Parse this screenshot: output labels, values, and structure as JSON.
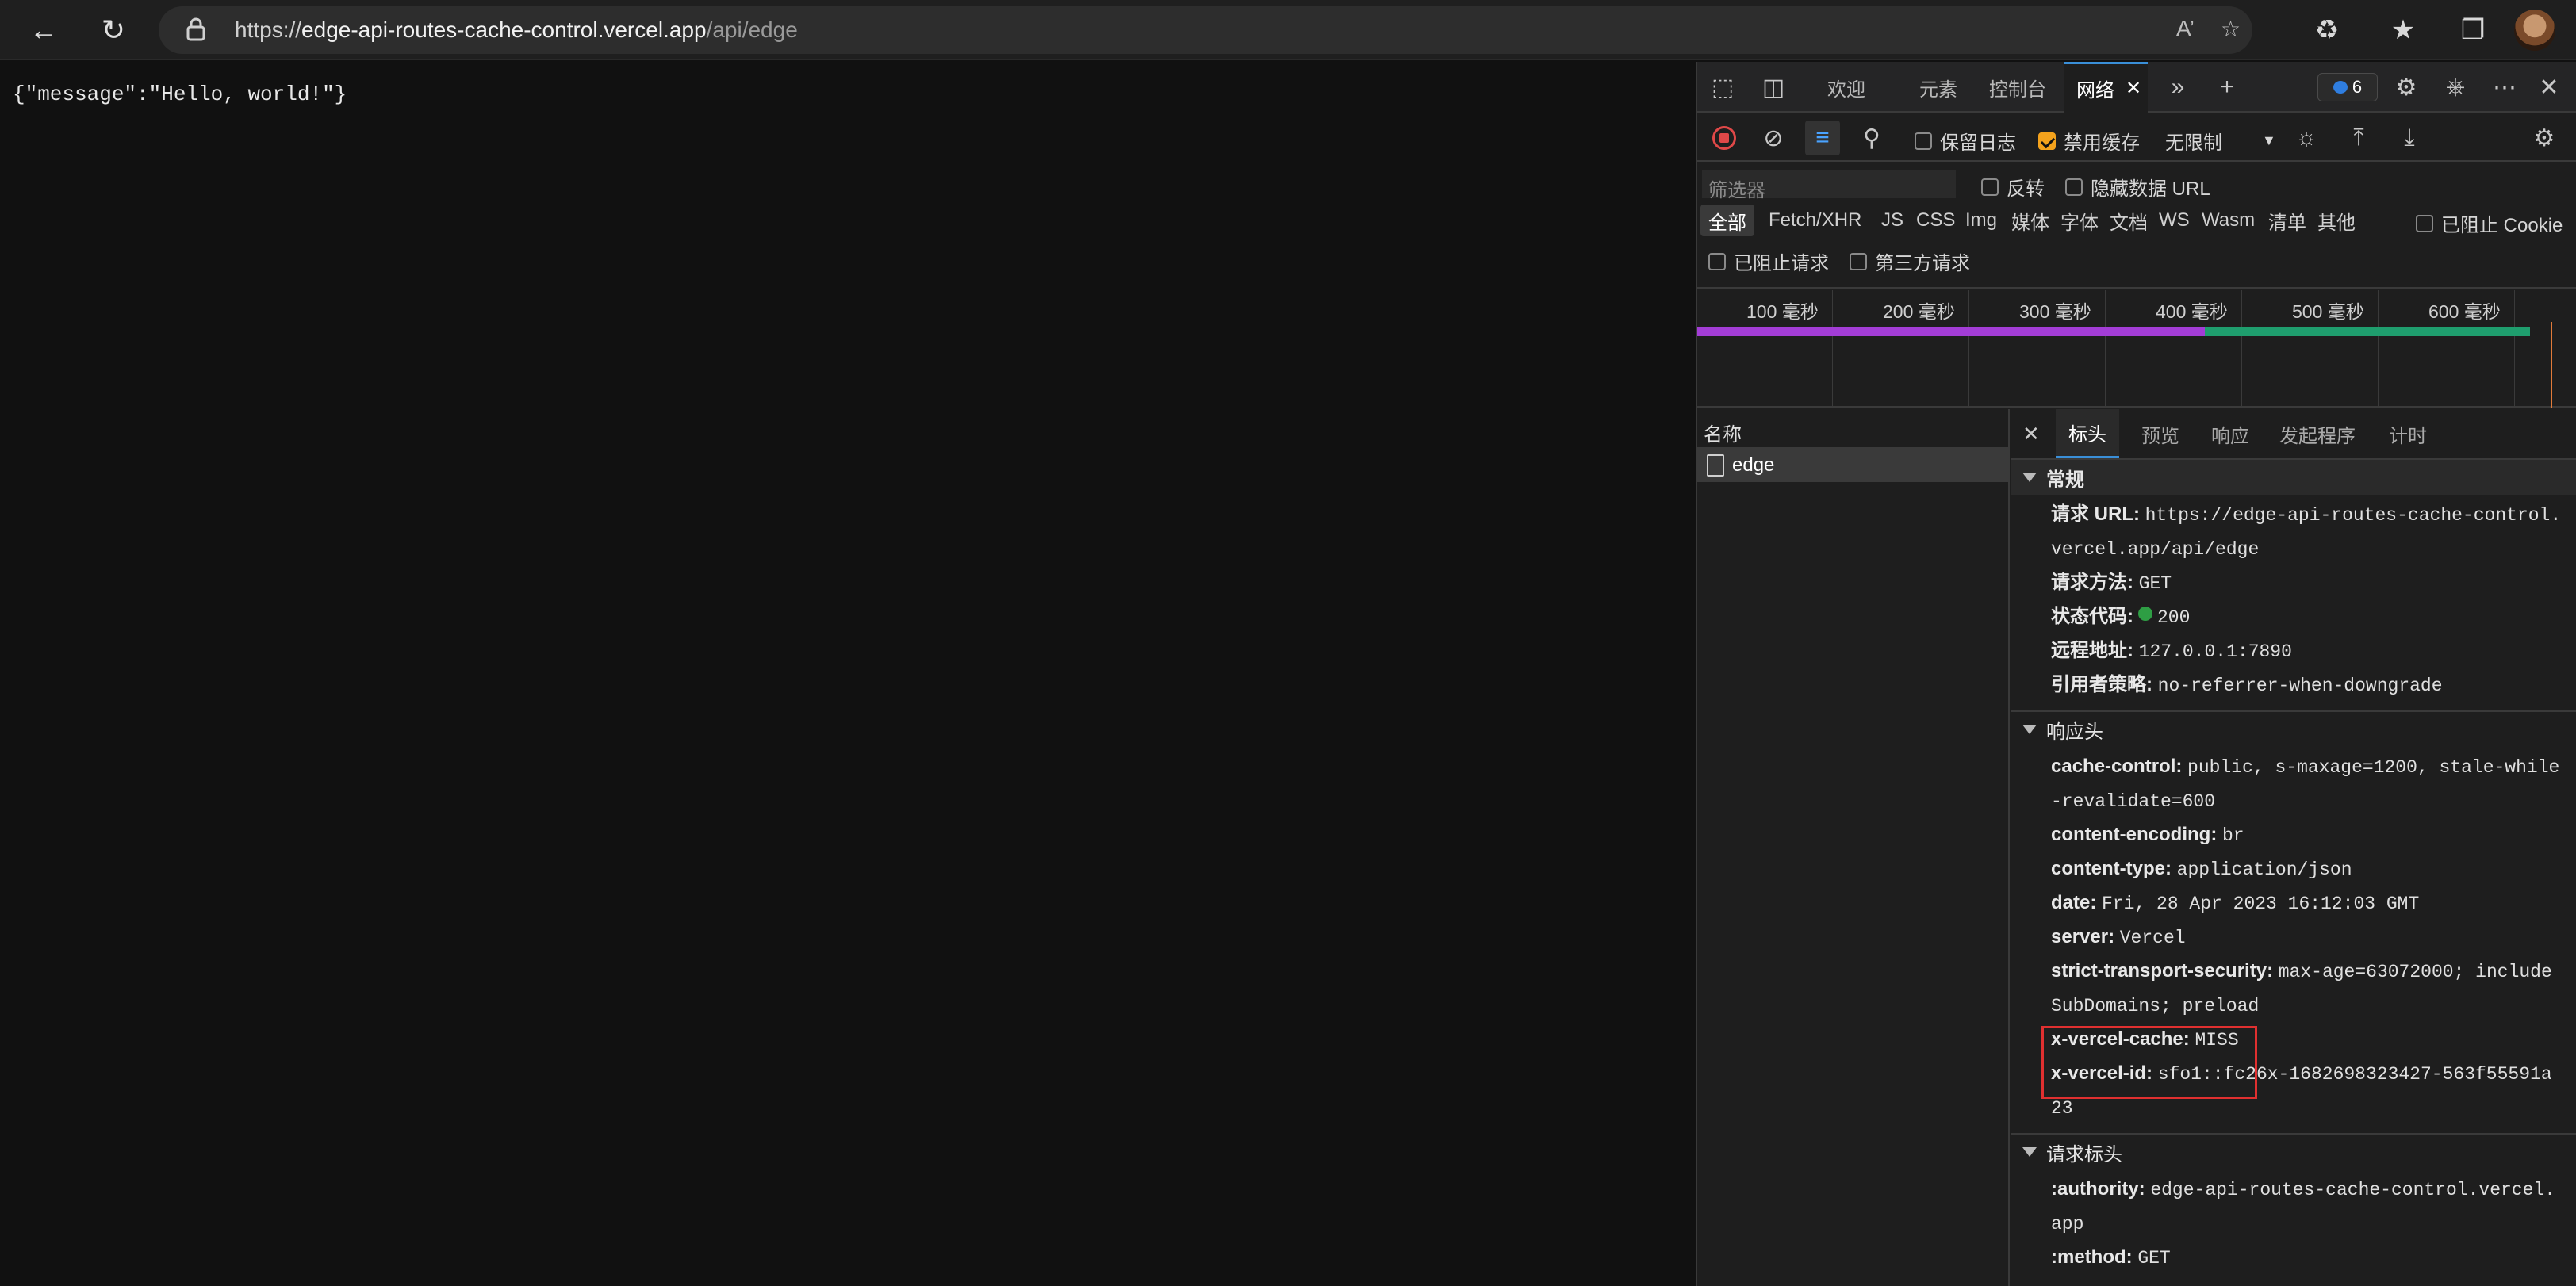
{
  "browser": {
    "url_scheme": "https://",
    "url_host": "edge-api-routes-cache-control.vercel.app",
    "url_path": "/api/edge",
    "read_aloud_label": "A’"
  },
  "page": {
    "body": "{\"message\":\"Hello, world!\"}"
  },
  "devtools": {
    "tabs": [
      "欢迎",
      "元素",
      "控制台",
      "网络"
    ],
    "issues_count": "6",
    "toolbar": {
      "preserve_log": "保留日志",
      "disable_cache": "禁用缓存",
      "throttle": "无限制"
    },
    "filter": {
      "placeholder": "筛选器",
      "invert": "反转",
      "hide_data_urls": "隐藏数据 URL",
      "types": [
        "全部",
        "Fetch/XHR",
        "JS",
        "CSS",
        "Img",
        "媒体",
        "字体",
        "文档",
        "WS",
        "Wasm",
        "清单",
        "其他"
      ],
      "blocked_cookies": "已阻止 Cookie",
      "blocked_requests": "已阻止请求",
      "third_party": "第三方请求"
    },
    "timeline": {
      "ticks": [
        "100 毫秒",
        "200 毫秒",
        "300 毫秒",
        "400 毫秒",
        "500 毫秒",
        "600 毫秒"
      ]
    },
    "requests": {
      "name_header": "名称",
      "items": [
        "edge"
      ]
    },
    "detail_tabs": [
      "标头",
      "预览",
      "响应",
      "发起程序",
      "计时"
    ],
    "general": {
      "title": "常规",
      "request_url_key": "请求 URL:",
      "request_url": "https://edge-api-routes-cache-control.vercel.app/api/edge",
      "method_key": "请求方法:",
      "method": "GET",
      "status_key": "状态代码:",
      "status": "200",
      "remote_key": "远程地址:",
      "remote": "127.0.0.1:7890",
      "referrer_key": "引用者策略:",
      "referrer": "no-referrer-when-downgrade"
    },
    "response_headers": {
      "title": "响应头",
      "items": [
        {
          "k": "cache-control:",
          "v": "public, s-maxage=1200, stale-while-revalidate=600"
        },
        {
          "k": "content-encoding:",
          "v": "br"
        },
        {
          "k": "content-type:",
          "v": "application/json"
        },
        {
          "k": "date:",
          "v": "Fri, 28 Apr 2023 16:12:03 GMT"
        },
        {
          "k": "server:",
          "v": "Vercel"
        },
        {
          "k": "strict-transport-security:",
          "v": "max-age=63072000; includeSubDomains; preload"
        },
        {
          "k": "x-vercel-cache:",
          "v": "MISS"
        },
        {
          "k": "x-vercel-id:",
          "v": "sfo1::fc26x-1682698323427-563f55591a23"
        }
      ]
    },
    "request_headers": {
      "title": "请求标头",
      "items": [
        {
          "k": ":authority:",
          "v": "edge-api-routes-cache-control.vercel.app"
        },
        {
          "k": ":method:",
          "v": "GET"
        }
      ]
    }
  }
}
